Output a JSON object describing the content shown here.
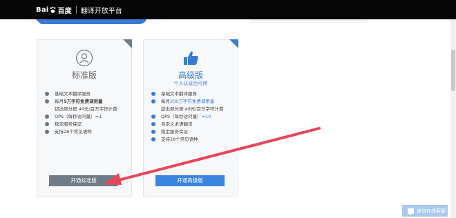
{
  "header": {
    "logo_text_1": "Bai",
    "logo_text_2": "百度",
    "title": "翻译开放平台"
  },
  "plans": [
    {
      "name": "标准版",
      "icon": "user-icon",
      "features": [
        "基础文本翻译服务",
        "每月5万字符免费调用量",
        "超出部分按 49元/百万字符计费",
        "QPS（每秒访问量）=1",
        "稳定服务保证",
        "支持28个常见语种"
      ],
      "button": "开通标准版"
    },
    {
      "name": "高级版",
      "icon": "thumbs-up-icon",
      "subtitle": "个人认证后可用",
      "features": [
        "基础文本翻译服务",
        "每月200万字符免费调用量",
        "超出部分按 49元/百万字符计费",
        "QPS（每秒访问量）=10",
        "自定义术语翻译",
        "稳定服务保证",
        "支持28个常见语种"
      ],
      "button": "开通高级版"
    }
  ],
  "features_rich": {
    "std_quota_prefix": "每月",
    "std_quota_highlight": "5万字符免费调用量",
    "adv_quota_prefix": "每月",
    "adv_quota_highlight": "200万字符免费调用量",
    "adv_qps_prefix": "QPS（每秒访问量）=",
    "adv_qps_value": "10"
  },
  "chat": {
    "label": "咨询在线客服",
    "icon": "chat-icon"
  },
  "colors": {
    "accent": "#3a7bd5",
    "gray_button": "#717b87",
    "arrow": "#e8455a"
  }
}
